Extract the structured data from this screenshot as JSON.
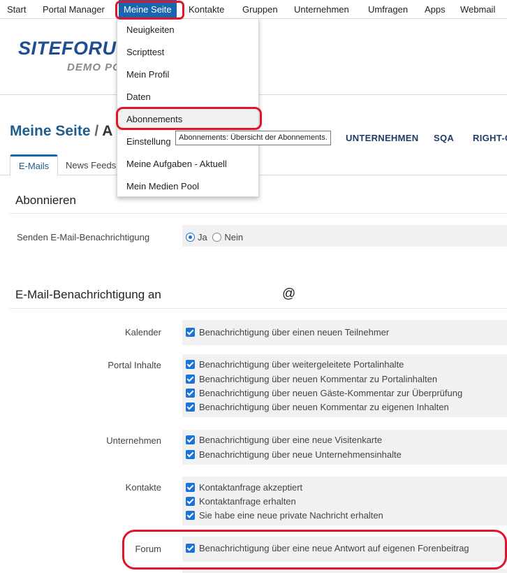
{
  "topnav": {
    "items": [
      "Start",
      "Portal Manager",
      "Meine Seite",
      "Kontakte",
      "Gruppen",
      "Unternehmen",
      "Umfragen",
      "Apps",
      "Webmail"
    ]
  },
  "header": {
    "logo": "SITEFORU",
    "logo_sub": "DEMO PO"
  },
  "page": {
    "title": "Meine Seite",
    "separator": "/",
    "title_rest": "A"
  },
  "secondary_nav": [
    "UNTERNEHMEN",
    "SQA",
    "RIGHT-C"
  ],
  "tabs": [
    "E-Mails",
    "News Feeds"
  ],
  "dropdown": {
    "items": [
      "Neuigkeiten",
      "Scripttest",
      "Mein Profil",
      "Daten",
      "Abonnements",
      "Einstellung",
      "Meine Aufgaben - Aktuell",
      "Mein Medien Pool"
    ]
  },
  "tooltip": "Abonnements: Übersicht der Abonnements.",
  "abonnieren": {
    "title": "Abonnieren",
    "label": "Senden E-Mail-Benachrichtigung",
    "options": [
      "Ja",
      "Nein"
    ],
    "selected": "Ja"
  },
  "notify": {
    "title": "E-Mail-Benachrichtigung an",
    "email_sign": "@",
    "groups": [
      {
        "label": "Kalender",
        "options": [
          "Benachrichtigung über einen neuen Teilnehmer"
        ]
      },
      {
        "label": "Portal Inhalte",
        "options": [
          "Benachrichtigung über weitergeleitete Portalinhalte",
          "Benachrichtigung über neuen Kommentar zu Portalinhalten",
          "Benachrichtigung über neuen Gäste-Kommentar zur Überprüfung",
          "Benachrichtigung über neuen Kommentar zu eigenen Inhalten"
        ]
      },
      {
        "label": "Unternehmen",
        "options": [
          "Benachrichtigung über eine neue Visitenkarte",
          "Benachrichtigung über neue Unternehmensinhalte"
        ]
      },
      {
        "label": "Kontakte",
        "options": [
          "Kontaktanfrage akzeptiert",
          "Kontaktanfrage erhalten",
          "Sie habe eine neue private Nachricht erhalten"
        ]
      },
      {
        "label": "Forum",
        "options": [
          "Benachrichtigung über eine neue Antwort auf eigenen Forenbeitrag"
        ]
      }
    ]
  },
  "colors": {
    "accent": "#1a65b0",
    "checkbox": "#1a73d9",
    "callout": "#e0142a",
    "title": "#1f5d8c"
  }
}
